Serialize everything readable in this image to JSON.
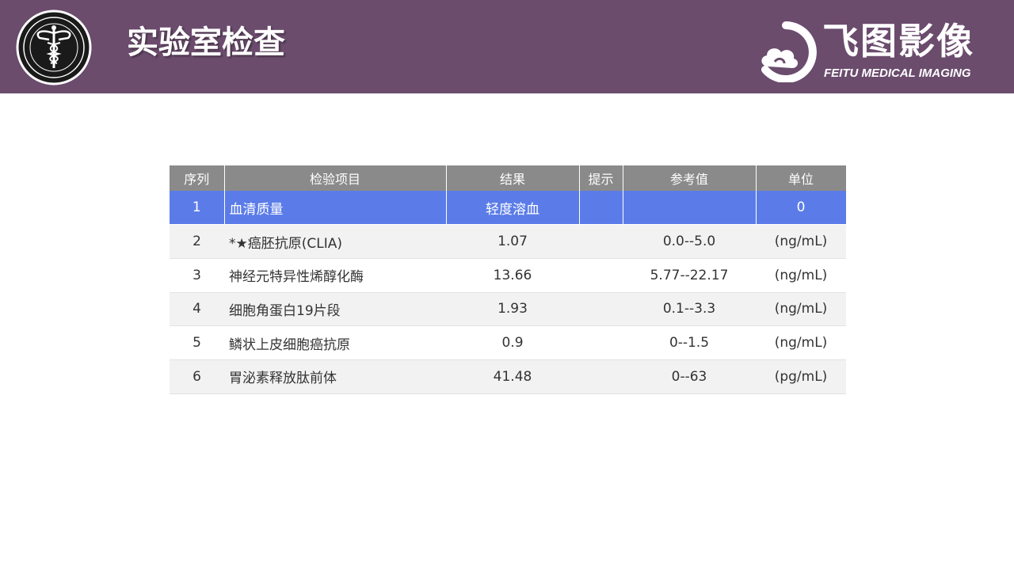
{
  "header": {
    "title": "实验室检查",
    "brand_cn": "飞图影像",
    "brand_en": "FEITU MEDICAL IMAGING",
    "bg_color": "#6b4c6d"
  },
  "seal": {
    "icon": "caduceus-icon"
  },
  "table": {
    "columns": [
      "序列",
      "检验项目",
      "结果",
      "提示",
      "参考值",
      "单位"
    ],
    "rows": [
      {
        "no": "1",
        "item": "血清质量",
        "result": "轻度溶血",
        "flag": "",
        "ref": "",
        "unit": "0"
      },
      {
        "no": "2",
        "item": "*★癌胚抗原(CLIA)",
        "result": "1.07",
        "flag": "",
        "ref": "0.0--5.0",
        "unit": "(ng/mL)"
      },
      {
        "no": "3",
        "item": "神经元特异性烯醇化酶",
        "result": "13.66",
        "flag": "",
        "ref": "5.77--22.17",
        "unit": "(ng/mL)"
      },
      {
        "no": "4",
        "item": "细胞角蛋白19片段",
        "result": "1.93",
        "flag": "",
        "ref": "0.1--3.3",
        "unit": "(ng/mL)"
      },
      {
        "no": "5",
        "item": "鳞状上皮细胞癌抗原",
        "result": "0.9",
        "flag": "",
        "ref": "0--1.5",
        "unit": "(ng/mL)"
      },
      {
        "no": "6",
        "item": "胃泌素释放肽前体",
        "result": "41.48",
        "flag": "",
        "ref": "0--63",
        "unit": "(pg/mL)"
      }
    ],
    "highlight_color": "#5b7ce8",
    "header_color": "#8a8a8a"
  }
}
